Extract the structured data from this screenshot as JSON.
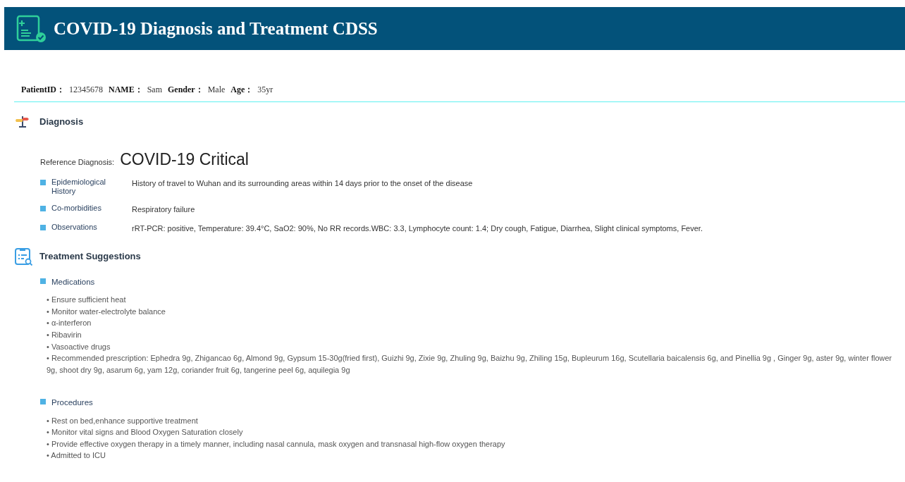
{
  "header": {
    "title": "COVID-19 Diagnosis and Treatment CDSS"
  },
  "patient": [
    {
      "label": "PatientID：",
      "value": "12345678"
    },
    {
      "label": "NAME：",
      "value": "Sam"
    },
    {
      "label": "Gender：",
      "value": "Male"
    },
    {
      "label": "Age：",
      "value": "35yr"
    }
  ],
  "diagnosis": {
    "heading": "Diagnosis",
    "reference_label": "Reference Diagnosis:",
    "reference_value": "COVID-19 Critical",
    "rows": [
      {
        "label": "Epidemiological History",
        "text": "History of travel to Wuhan and its surrounding areas within 14 days prior to the onset of the disease"
      },
      {
        "label": "Co-morbidities",
        "text": "Respiratory failure"
      },
      {
        "label": "Observations",
        "text": "rRT-PCR: positive, Temperature: 39.4°C, SaO2: 90%, No RR records.WBC: 3.3, Lymphocyte count: 1.4; Dry cough, Fatigue, Diarrhea, Slight clinical symptoms, Fever."
      }
    ]
  },
  "treatment": {
    "heading": "Treatment Suggestions",
    "sections": [
      {
        "title": "Medications",
        "items": [
          "• Ensure sufficient heat",
          "• Monitor water-electrolyte balance",
          "• α-interferon",
          "• Ribavirin",
          "• Vasoactive drugs",
          "• Recommended prescription: Ephedra 9g, Zhigancao 6g, Almond 9g, Gypsum 15-30g(fried first), Guizhi 9g, Zixie 9g, Zhuling 9g, Baizhu 9g, Zhiling 15g, Bupleurum 16g, Scutellaria baicalensis 6g, and Pinellia 9g , Ginger 9g, aster 9g, winter flower 9g, shoot dry 9g, asarum 6g, yam 12g, coriander fruit 6g, tangerine peel 6g, aquilegia 9g"
        ]
      },
      {
        "title": "Procedures",
        "items": [
          "• Rest on bed,enhance supportive treatment",
          "• Monitor vital signs and Blood Oxygen Saturation closely",
          "• Provide effective oxygen therapy in a timely manner, including nasal cannula, mask oxygen and transnasal high-flow oxygen therapy",
          "• Admitted to ICU"
        ]
      }
    ]
  }
}
